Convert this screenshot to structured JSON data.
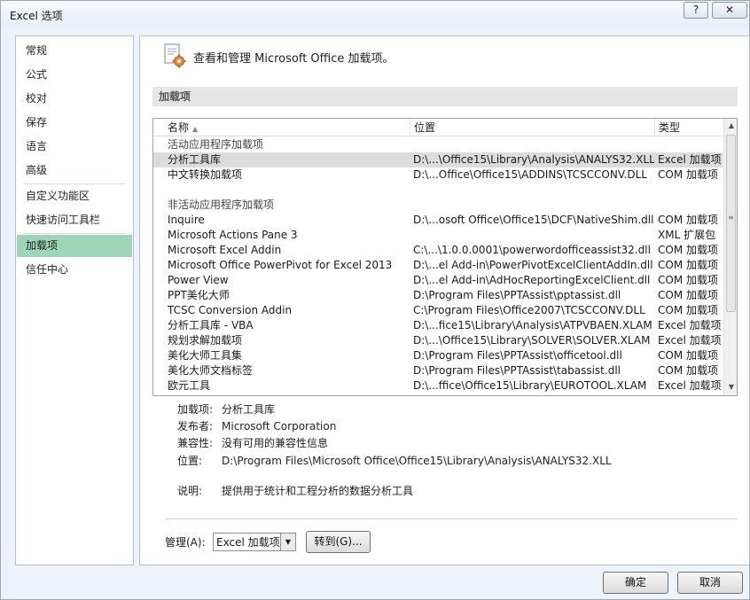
{
  "window": {
    "title": "Excel 选项",
    "help_label": "?",
    "close_label": "✕"
  },
  "nav": {
    "items": [
      {
        "label": "常规"
      },
      {
        "label": "公式"
      },
      {
        "label": "校对"
      },
      {
        "label": "保存"
      },
      {
        "label": "语言"
      },
      {
        "label": "高级"
      },
      {
        "label": "自定义功能区"
      },
      {
        "label": "快速访问工具栏"
      },
      {
        "label": "加载项",
        "active": true
      },
      {
        "label": "信任中心"
      }
    ]
  },
  "header": {
    "icon": "addins-gear-icon",
    "text": "查看和管理 Microsoft Office 加载项。"
  },
  "section": {
    "title": "加载项"
  },
  "list": {
    "columns": {
      "name": "名称",
      "location": "位置",
      "type": "类型",
      "sort_indicator": "▲"
    },
    "active_group_label": "活动应用程序加载项",
    "inactive_group_label": "非活动应用程序加载项",
    "active": [
      {
        "name": "分析工具库",
        "location": "D:\\...\\Office15\\Library\\Analysis\\ANALYS32.XLL",
        "type": "Excel 加载项",
        "selected": true
      },
      {
        "name": "中文转换加载项",
        "location": "D:\\...Office\\Office15\\ADDINS\\TCSCCONV.DLL",
        "type": "COM 加载项"
      }
    ],
    "inactive": [
      {
        "name": "Inquire",
        "location": "D:\\...osoft Office\\Office15\\DCF\\NativeShim.dll",
        "type": "COM 加载项"
      },
      {
        "name": "Microsoft Actions Pane 3",
        "location": "",
        "type": "XML 扩展包"
      },
      {
        "name": "Microsoft Excel Addin",
        "location": "C:\\...\\1.0.0.0001\\powerwordofficeassist32.dll",
        "type": "COM 加载项"
      },
      {
        "name": "Microsoft Office PowerPivot for Excel 2013",
        "location": "D:\\...el Add-in\\PowerPivotExcelClientAddIn.dll",
        "type": "COM 加载项"
      },
      {
        "name": "Power View",
        "location": "D:\\...el Add-in\\AdHocReportingExcelClient.dll",
        "type": "COM 加载项"
      },
      {
        "name": "PPT美化大师",
        "location": "D:\\Program Files\\PPTAssist\\pptassist.dll",
        "type": "COM 加载项"
      },
      {
        "name": "TCSC Conversion Addin",
        "location": "C:\\Program Files\\Office2007\\TCSCCONV.DLL",
        "type": "COM 加载项"
      },
      {
        "name": "分析工具库 - VBA",
        "location": "D:\\...fice15\\Library\\Analysis\\ATPVBAEN.XLAM",
        "type": "Excel 加载项"
      },
      {
        "name": "规划求解加载项",
        "location": "D:\\...\\Office15\\Library\\SOLVER\\SOLVER.XLAM",
        "type": "Excel 加载项"
      },
      {
        "name": "美化大师工具集",
        "location": "D:\\Program Files\\PPTAssist\\officetool.dll",
        "type": "COM 加载项"
      },
      {
        "name": "美化大师文档标签",
        "location": "D:\\Program Files\\PPTAssist\\tabassist.dll",
        "type": "COM 加载项"
      },
      {
        "name": "欧元工具",
        "location": "D:\\...ffice\\Office15\\Library\\EUROTOOL.XLAM",
        "type": "Excel 加载项"
      }
    ],
    "scroll": {
      "up": "▲",
      "down": "▼",
      "grip": "≡"
    }
  },
  "details": {
    "addin_label": "加载项:",
    "addin_value": "分析工具库",
    "publisher_label": "发布者:",
    "publisher_value": "Microsoft Corporation",
    "compat_label": "兼容性:",
    "compat_value": "没有可用的兼容性信息",
    "location_label": "位置:",
    "location_value": "D:\\Program Files\\Microsoft Office\\Office15\\Library\\Analysis\\ANALYS32.XLL",
    "desc_label": "说明:",
    "desc_value": "提供用于统计和工程分析的数据分析工具"
  },
  "manage": {
    "label": "管理(A):",
    "selected": "Excel 加载项",
    "dropdown_arrow": "▼",
    "goto_label": "转到(G)..."
  },
  "footer": {
    "ok_label": "确定",
    "cancel_label": "取消"
  }
}
